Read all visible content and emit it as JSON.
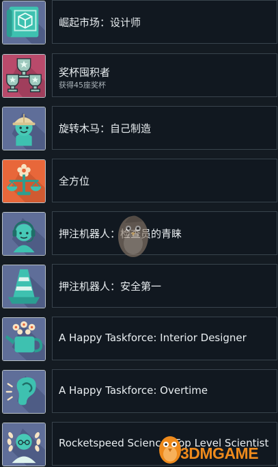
{
  "achievements": [
    {
      "title": "崛起市场：设计师",
      "icon": "blueprint-cube-icon"
    },
    {
      "title": "奖杯囤积者",
      "subtitle": "获得45座奖杯",
      "icon": "trophy-cups-icon"
    },
    {
      "title": "旋转木马：自己制造",
      "icon": "hardhat-robot-icon"
    },
    {
      "title": "全方位",
      "icon": "flower-scale-icon"
    },
    {
      "title": "押注机器人：检查员的青睐",
      "icon": "headset-robot-icon"
    },
    {
      "title": "押注机器人：安全第一",
      "icon": "traffic-cone-icon"
    },
    {
      "title": "A Happy Taskforce: Interior Designer",
      "icon": "watering-can-icon"
    },
    {
      "title": "A Happy Taskforce: Overtime",
      "icon": "ear-icon"
    },
    {
      "title": "Rocketspeed Science: Top Level Scientist",
      "icon": "laurel-scientist-icon"
    }
  ],
  "watermark": {
    "brand": "3DMGAME",
    "color": "#ee8a1c"
  }
}
